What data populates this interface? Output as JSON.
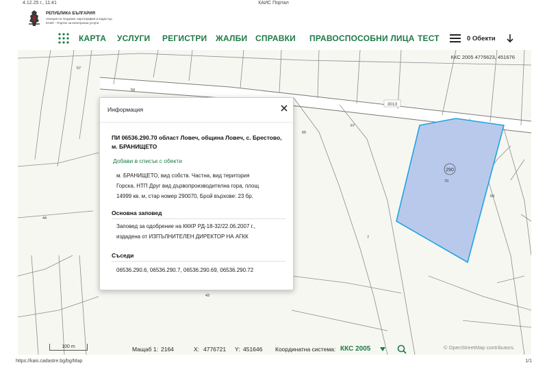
{
  "print_header": {
    "datetime": "4.12.25 г., 11:41",
    "page_title": "КАИС Портал"
  },
  "logo": {
    "line1": "РЕПУБЛИКА БЪЛГАРИЯ",
    "line2": "Агенция по геодезия, картография и кадастър",
    "line3": "КАИС - Портал за електронни услуги"
  },
  "nav": {
    "items": [
      "КАРТА",
      "УСЛУГИ",
      "РЕГИСТРИ",
      "ЖАЛБИ",
      "СПРАВКИ",
      "ПРАВОСПОСОБНИ ЛИЦА",
      "ТЕСТ"
    ],
    "objects_label": "0 Обекти"
  },
  "map": {
    "coord_readout": "ККС 2005 4776623, 451676",
    "road_label": "3013",
    "selected_parcel_label": "290",
    "parcel_numbers": [
      "57",
      "59",
      "65",
      "67",
      "44",
      "70",
      "69",
      "43",
      "7"
    ],
    "highlight_fill": "#b9c9ec",
    "highlight_stroke": "#1fa3e0"
  },
  "popup": {
    "title": "Информация",
    "parcel": "ПИ 06536.290.70 област Ловеч, община Ловеч, с. Брестово, м. БРАНИЩЕТО",
    "add_link": "Добави в списък с обекти",
    "description_lines": [
      "м. БРАНИЩЕТО, вид собств. Частна, вид територия",
      "Горска, НТП Друг вид дървопроизводителна гора, площ",
      "14999 кв. м, стар номер 290070, Брой върхове: 23 бр."
    ],
    "order_header": "Основна заповед",
    "order_lines": [
      "Заповед за одобрение на КККР РД-18-32/22.06.2007 г.,",
      "издадена от ИЗПЪЛНИТЕЛЕН ДИРЕКТОР НА АГКК"
    ],
    "neighbors_header": "Съседи",
    "neighbors": "06536.290.6, 06536.290.7, 06536.290.69, 06536.290.72"
  },
  "footer": {
    "scale_bar": "100 m",
    "scale_label": "Мащаб 1:",
    "scale_value": "2164",
    "x_label": "X:",
    "x_value": "4776721",
    "y_label": "Y:",
    "y_value": "451646",
    "crs_label": "Координатна система:",
    "crs_value": "ККС 2005",
    "osm_credit": "© OpenStreetMap contributors."
  },
  "print_footer": {
    "url": "https://kais.cadastre.bg/bg/Map",
    "page": "1/1"
  },
  "colors": {
    "accent": "#1e7a46"
  }
}
